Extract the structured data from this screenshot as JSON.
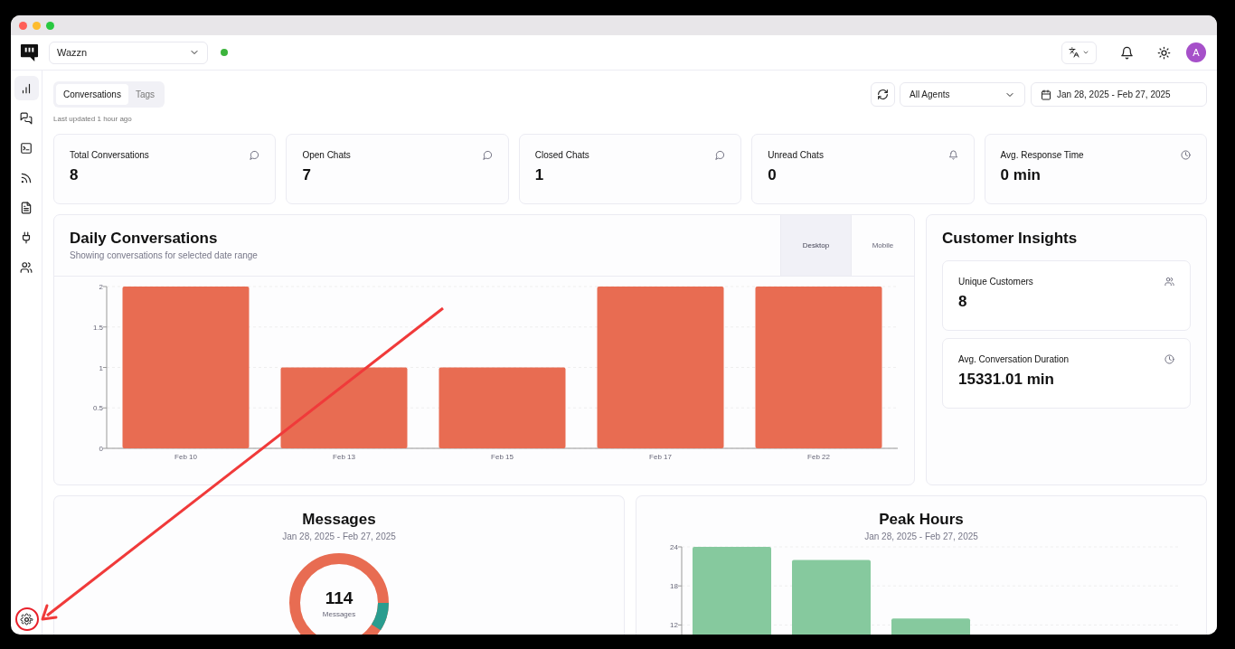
{
  "header": {
    "workspace": "Wazzn",
    "online": true,
    "avatar": "A"
  },
  "sidebar": {
    "items": [
      {
        "selected": true
      },
      {
        "selected": false
      },
      {
        "selected": false
      },
      {
        "selected": false
      },
      {
        "selected": false
      },
      {
        "selected": false
      },
      {
        "selected": false
      }
    ]
  },
  "tabs": [
    {
      "label": "Conversations",
      "selected": true
    },
    {
      "label": "Tags",
      "selected": false
    }
  ],
  "last_updated": "Last updated 1 hour ago",
  "agent_filter": "All Agents",
  "date_range": "Jan 28, 2025 - Feb 27, 2025",
  "stats": [
    {
      "title": "Total Conversations",
      "value": "8",
      "kind": "chat"
    },
    {
      "title": "Open Chats",
      "value": "7",
      "kind": "chat"
    },
    {
      "title": "Closed Chats",
      "value": "1",
      "kind": "chat"
    },
    {
      "title": "Unread Chats",
      "value": "0",
      "kind": "bell"
    },
    {
      "title": "Avg. Response Time",
      "value": "0 min",
      "kind": "clock"
    }
  ],
  "daily": {
    "title": "Daily Conversations",
    "subtitle": "Showing conversations for selected date range",
    "toggle": [
      {
        "label": "Desktop",
        "selected": true
      },
      {
        "label": "Mobile",
        "selected": false
      }
    ],
    "chart_data": {
      "type": "bar",
      "categories": [
        "Feb 10",
        "Feb 13",
        "Feb 15",
        "Feb 17",
        "Feb 22"
      ],
      "series": [
        {
          "color": "#e86c52",
          "values": [
            2,
            1,
            1,
            2,
            2
          ]
        }
      ],
      "ylim": [
        0,
        2
      ],
      "yticks": [
        0,
        0.5,
        1,
        1.5,
        2
      ],
      "grid": true
    }
  },
  "insights": {
    "title": "Customer Insights",
    "items": [
      {
        "title": "Unique Customers",
        "value": "8",
        "kind": "users"
      },
      {
        "title": "Avg. Conversation Duration",
        "value": "15331.01 min",
        "kind": "clock"
      }
    ]
  },
  "messages": {
    "title": "Messages",
    "subtitle": "Jan 28, 2025 - Feb 27, 2025",
    "total": "114",
    "total_label": "Messages"
  },
  "peak": {
    "title": "Peak Hours",
    "subtitle": "Jan 28, 2025 - Feb 27, 2025",
    "chart_data": {
      "type": "bar",
      "series": [
        {
          "color": "#86c99e",
          "values": [
            24,
            22,
            13
          ]
        }
      ],
      "ylim": [
        0,
        24
      ],
      "yticks": [
        12,
        18,
        24
      ],
      "grid": true
    }
  }
}
